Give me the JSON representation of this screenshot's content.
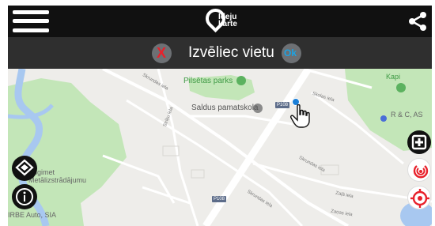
{
  "header": {
    "logo_line1": "Ideju",
    "logo_line2": "karte"
  },
  "titlebar": {
    "title": "Izvēliec vietu",
    "cancel_symbol": "X",
    "confirm_label": "Ok"
  },
  "map": {
    "labels": {
      "park": "Pilsētas parks",
      "school": "Saldus pamatskola",
      "kapi": "Kapi",
      "rc_as": "R & C, AS",
      "business1_line1": "Būgimet",
      "business1_line2": "Metālizstrādājumu",
      "business2": "IRBE Auto, SIA"
    },
    "road_badges": {
      "p108_top": "P108",
      "p108_bottom": "P108"
    },
    "street_labels": {
      "s1": "Skrundas iela",
      "s2": "Striķu iela",
      "s3": "Skolas iela",
      "s4": "Skrundas iela",
      "s5": "Zaļā iela",
      "s6": "Skrundas iela",
      "s7": "Zaņas iela"
    }
  },
  "colors": {
    "topbar": "#111111",
    "titlebar": "#2f2f2f",
    "cancel_red": "#e8212b",
    "confirm_blue": "#1ca3e3",
    "park_green": "#c3e6b8",
    "water_blue": "#a8c8f0",
    "marker_blue": "#1a7fd8",
    "locate_red": "#e8212b"
  },
  "icons": {
    "menu": "hamburger-menu-icon",
    "share": "share-icon",
    "logo": "map-pin-logo-icon",
    "cancel": "close-icon",
    "confirm": "ok-icon",
    "layers": "layers-icon",
    "info": "info-icon",
    "add": "add-icon",
    "track": "track-icon",
    "locate": "locate-icon",
    "cursor": "hand-cursor-icon",
    "marker": "location-marker-icon"
  }
}
